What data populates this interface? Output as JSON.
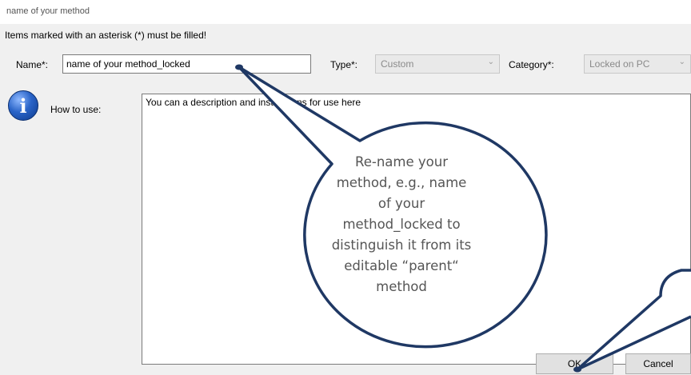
{
  "window": {
    "title": "name of your method"
  },
  "notice": "Items marked with an asterisk (*) must be filled!",
  "form": {
    "name_label": "Name*:",
    "name_value": "name of your method_locked",
    "type_label": "Type*:",
    "type_value": "Custom",
    "category_label": "Category*:",
    "category_value": "Locked on PC",
    "how_to_use_label": "How to use:",
    "description": "You can a description and instructions for use here"
  },
  "buttons": {
    "ok": "OK",
    "cancel": "Cancel"
  },
  "callout": {
    "text": "Re-name your method, e.g., name of your method_locked to distinguish it from its editable “parent“ method"
  },
  "icons": {
    "info": "info-icon",
    "dropdown": "chevron-down-icon"
  },
  "colors": {
    "callout_fill": "#ffffff",
    "callout_stroke": "#1f3864",
    "info_icon": "#2a64c8"
  }
}
